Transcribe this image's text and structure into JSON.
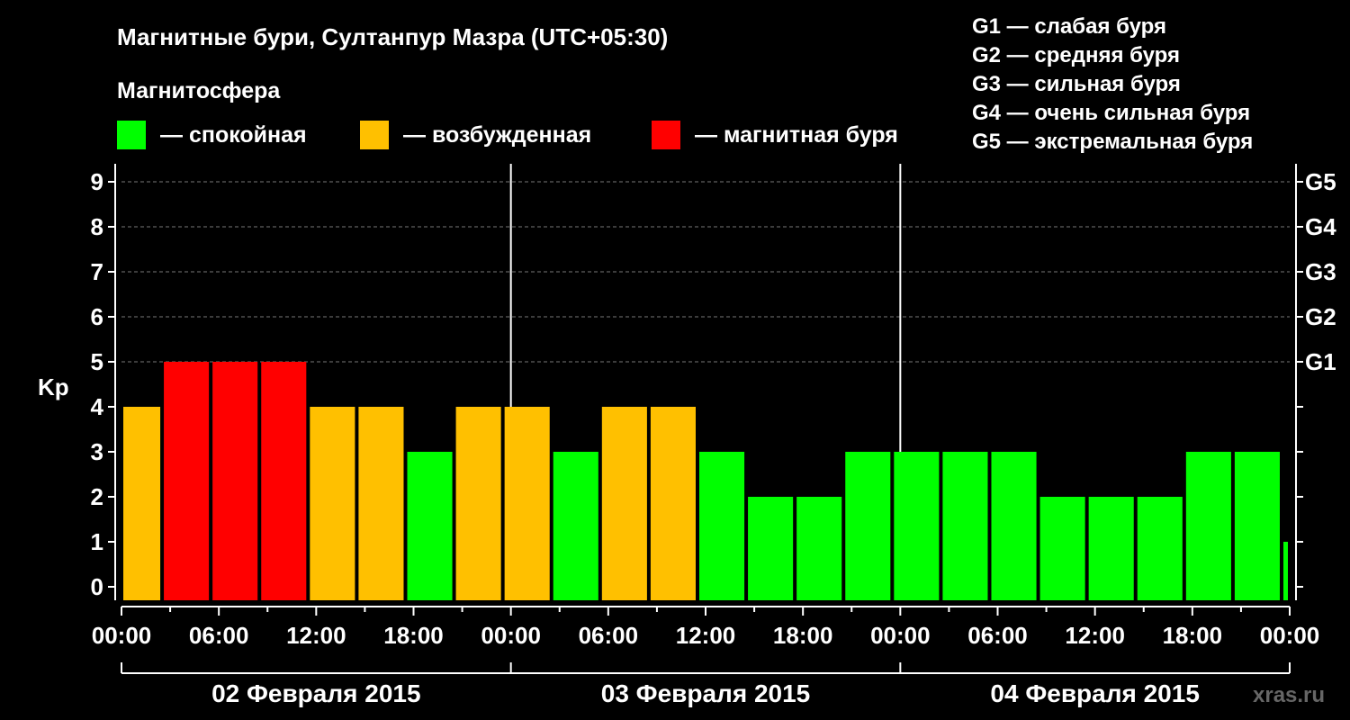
{
  "chart_data": {
    "type": "bar",
    "title": "Магнитные бури, Султанпур Мазра (UTC+05:30)",
    "legend": {
      "heading": "Магнитосфера",
      "items": [
        {
          "label": "— спокойная",
          "color": "#00ff00"
        },
        {
          "label": "— возбужденная",
          "color": "#ffc000"
        },
        {
          "label": "— магнитная буря",
          "color": "#ff0000"
        }
      ]
    },
    "g_scale": [
      "G1 — слабая буря",
      "G2 — средняя буря",
      "G3 — сильная буря",
      "G4 — очень сильная буря",
      "G5 — экстремальная буря"
    ],
    "ylabel": "Kp",
    "ylim": [
      0,
      9
    ],
    "y_ticks": [
      "0",
      "1",
      "2",
      "3",
      "4",
      "5",
      "6",
      "7",
      "8",
      "9"
    ],
    "right_labels": [
      {
        "kp": 5,
        "label": "G1"
      },
      {
        "kp": 6,
        "label": "G2"
      },
      {
        "kp": 7,
        "label": "G3"
      },
      {
        "kp": 8,
        "label": "G4"
      },
      {
        "kp": 9,
        "label": "G5"
      }
    ],
    "x_tick_labels": [
      "00:00",
      "06:00",
      "12:00",
      "18:00",
      "00:00",
      "06:00",
      "12:00",
      "18:00",
      "00:00",
      "06:00",
      "12:00",
      "18:00",
      "00:00"
    ],
    "days": [
      "02 Февраля 2015",
      "03 Февраля 2015",
      "04 Февраля 2015"
    ],
    "x_range_hours": [
      0,
      72
    ],
    "bars": [
      {
        "start": 0,
        "end": 2.5,
        "kp": 4,
        "color": "#ffc000"
      },
      {
        "start": 2.5,
        "end": 5.5,
        "kp": 5,
        "color": "#ff0000"
      },
      {
        "start": 5.5,
        "end": 8.5,
        "kp": 5,
        "color": "#ff0000"
      },
      {
        "start": 8.5,
        "end": 11.5,
        "kp": 5,
        "color": "#ff0000"
      },
      {
        "start": 11.5,
        "end": 14.5,
        "kp": 4,
        "color": "#ffc000"
      },
      {
        "start": 14.5,
        "end": 17.5,
        "kp": 4,
        "color": "#ffc000"
      },
      {
        "start": 17.5,
        "end": 20.5,
        "kp": 3,
        "color": "#00ff00"
      },
      {
        "start": 20.5,
        "end": 23.5,
        "kp": 4,
        "color": "#ffc000"
      },
      {
        "start": 23.5,
        "end": 26.5,
        "kp": 4,
        "color": "#ffc000"
      },
      {
        "start": 26.5,
        "end": 29.5,
        "kp": 3,
        "color": "#00ff00"
      },
      {
        "start": 29.5,
        "end": 32.5,
        "kp": 4,
        "color": "#ffc000"
      },
      {
        "start": 32.5,
        "end": 35.5,
        "kp": 4,
        "color": "#ffc000"
      },
      {
        "start": 35.5,
        "end": 38.5,
        "kp": 3,
        "color": "#00ff00"
      },
      {
        "start": 38.5,
        "end": 41.5,
        "kp": 2,
        "color": "#00ff00"
      },
      {
        "start": 41.5,
        "end": 44.5,
        "kp": 2,
        "color": "#00ff00"
      },
      {
        "start": 44.5,
        "end": 47.5,
        "kp": 3,
        "color": "#00ff00"
      },
      {
        "start": 47.5,
        "end": 50.5,
        "kp": 3,
        "color": "#00ff00"
      },
      {
        "start": 50.5,
        "end": 53.5,
        "kp": 3,
        "color": "#00ff00"
      },
      {
        "start": 53.5,
        "end": 56.5,
        "kp": 3,
        "color": "#00ff00"
      },
      {
        "start": 56.5,
        "end": 59.5,
        "kp": 2,
        "color": "#00ff00"
      },
      {
        "start": 59.5,
        "end": 62.5,
        "kp": 2,
        "color": "#00ff00"
      },
      {
        "start": 62.5,
        "end": 65.5,
        "kp": 2,
        "color": "#00ff00"
      },
      {
        "start": 65.5,
        "end": 68.5,
        "kp": 3,
        "color": "#00ff00"
      },
      {
        "start": 68.5,
        "end": 71.5,
        "kp": 3,
        "color": "#00ff00"
      },
      {
        "start": 71.5,
        "end": 72,
        "kp": 1,
        "color": "#00ff00"
      }
    ],
    "watermark": "xras.ru"
  }
}
